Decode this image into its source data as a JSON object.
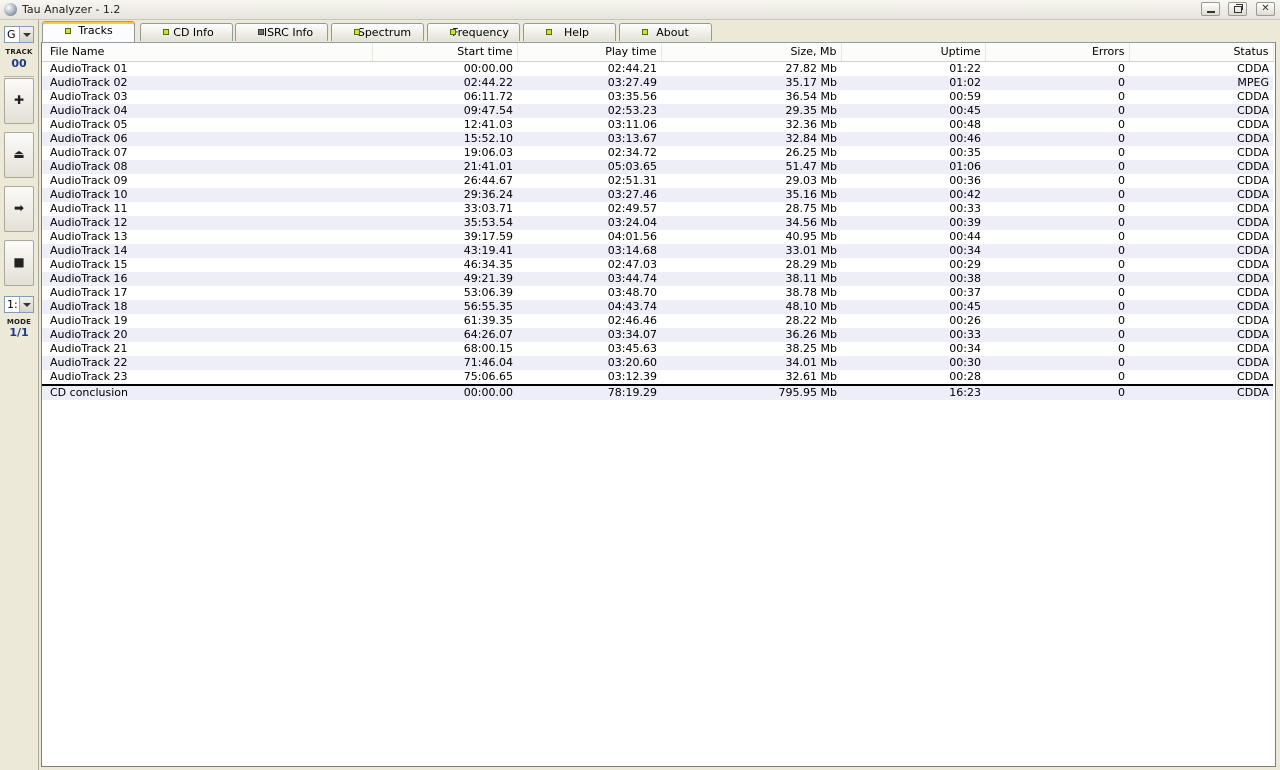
{
  "window": {
    "title": "Tau Analyzer - 1.2"
  },
  "left_panel": {
    "drive_combo_value": "G",
    "track_label": "TRACK",
    "track_number": "00",
    "buttons": [
      {
        "name": "add",
        "glyph": "✚"
      },
      {
        "name": "eject",
        "glyph": "⏏"
      },
      {
        "name": "next",
        "glyph": "➡"
      },
      {
        "name": "stop",
        "glyph": "■"
      }
    ],
    "mode_combo_value": "1:",
    "mode_label": "MODE",
    "mode_value": "1/1"
  },
  "tabs": [
    {
      "label": "Tracks",
      "active": true,
      "led": "green"
    },
    {
      "label": "CD Info",
      "active": false,
      "led": "green"
    },
    {
      "label": "ISRC Info",
      "active": false,
      "led": "gray"
    },
    {
      "label": "Spectrum",
      "active": false,
      "led": "green"
    },
    {
      "label": "Frequency",
      "active": false,
      "led": "green"
    },
    {
      "label": "Help",
      "active": false,
      "led": "green"
    },
    {
      "label": "About",
      "active": false,
      "led": "green"
    }
  ],
  "table": {
    "columns": [
      "File Name",
      "Start time",
      "Play time",
      "Size, Mb",
      "Uptime",
      "Errors",
      "Status"
    ],
    "rows": [
      [
        "AudioTrack 01",
        "00:00.00",
        "02:44.21",
        "27.82 Mb",
        "01:22",
        "0",
        "CDDA"
      ],
      [
        "AudioTrack 02",
        "02:44.22",
        "03:27.49",
        "35.17 Mb",
        "01:02",
        "0",
        "MPEG"
      ],
      [
        "AudioTrack 03",
        "06:11.72",
        "03:35.56",
        "36.54 Mb",
        "00:59",
        "0",
        "CDDA"
      ],
      [
        "AudioTrack 04",
        "09:47.54",
        "02:53.23",
        "29.35 Mb",
        "00:45",
        "0",
        "CDDA"
      ],
      [
        "AudioTrack 05",
        "12:41.03",
        "03:11.06",
        "32.36 Mb",
        "00:48",
        "0",
        "CDDA"
      ],
      [
        "AudioTrack 06",
        "15:52.10",
        "03:13.67",
        "32.84 Mb",
        "00:46",
        "0",
        "CDDA"
      ],
      [
        "AudioTrack 07",
        "19:06.03",
        "02:34.72",
        "26.25 Mb",
        "00:35",
        "0",
        "CDDA"
      ],
      [
        "AudioTrack 08",
        "21:41.01",
        "05:03.65",
        "51.47 Mb",
        "01:06",
        "0",
        "CDDA"
      ],
      [
        "AudioTrack 09",
        "26:44.67",
        "02:51.31",
        "29.03 Mb",
        "00:36",
        "0",
        "CDDA"
      ],
      [
        "AudioTrack 10",
        "29:36.24",
        "03:27.46",
        "35.16 Mb",
        "00:42",
        "0",
        "CDDA"
      ],
      [
        "AudioTrack 11",
        "33:03.71",
        "02:49.57",
        "28.75 Mb",
        "00:33",
        "0",
        "CDDA"
      ],
      [
        "AudioTrack 12",
        "35:53.54",
        "03:24.04",
        "34.56 Mb",
        "00:39",
        "0",
        "CDDA"
      ],
      [
        "AudioTrack 13",
        "39:17.59",
        "04:01.56",
        "40.95 Mb",
        "00:44",
        "0",
        "CDDA"
      ],
      [
        "AudioTrack 14",
        "43:19.41",
        "03:14.68",
        "33.01 Mb",
        "00:34",
        "0",
        "CDDA"
      ],
      [
        "AudioTrack 15",
        "46:34.35",
        "02:47.03",
        "28.29 Mb",
        "00:29",
        "0",
        "CDDA"
      ],
      [
        "AudioTrack 16",
        "49:21.39",
        "03:44.74",
        "38.11 Mb",
        "00:38",
        "0",
        "CDDA"
      ],
      [
        "AudioTrack 17",
        "53:06.39",
        "03:48.70",
        "38.78 Mb",
        "00:37",
        "0",
        "CDDA"
      ],
      [
        "AudioTrack 18",
        "56:55.35",
        "04:43.74",
        "48.10 Mb",
        "00:45",
        "0",
        "CDDA"
      ],
      [
        "AudioTrack 19",
        "61:39.35",
        "02:46.46",
        "28.22 Mb",
        "00:26",
        "0",
        "CDDA"
      ],
      [
        "AudioTrack 20",
        "64:26.07",
        "03:34.07",
        "36.26 Mb",
        "00:33",
        "0",
        "CDDA"
      ],
      [
        "AudioTrack 21",
        "68:00.15",
        "03:45.63",
        "38.25 Mb",
        "00:34",
        "0",
        "CDDA"
      ],
      [
        "AudioTrack 22",
        "71:46.04",
        "03:20.60",
        "34.01 Mb",
        "00:30",
        "0",
        "CDDA"
      ],
      [
        "AudioTrack 23",
        "75:06.65",
        "03:12.39",
        "32.61 Mb",
        "00:28",
        "0",
        "CDDA"
      ]
    ],
    "summary": [
      "CD conclusion",
      "00:00.00",
      "78:19.29",
      "795.95 Mb",
      "16:23",
      "0",
      "CDDA"
    ]
  }
}
